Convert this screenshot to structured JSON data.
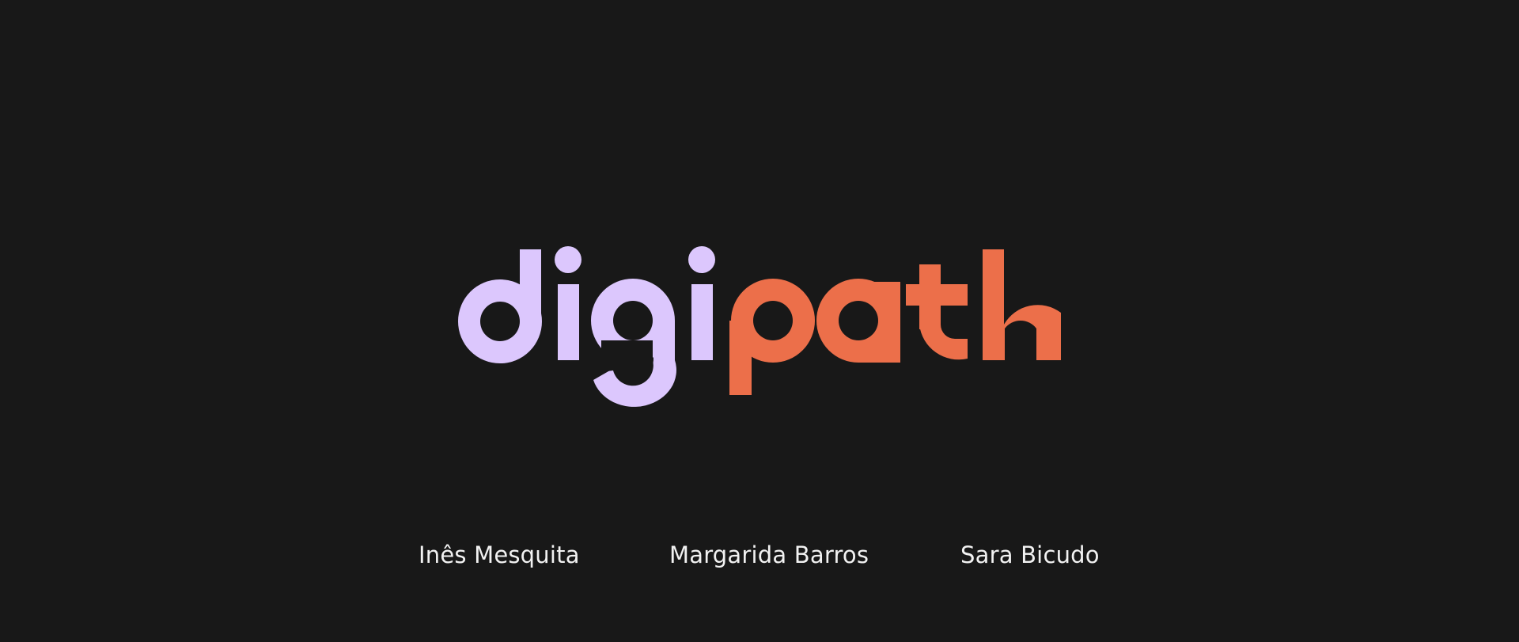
{
  "brand": {
    "wordmark": "digipath",
    "part_digi": "digi",
    "part_path": "path",
    "colors": {
      "background": "#181818",
      "digi": "#dcc7fd",
      "path": "#ec6f4a",
      "text": "#f2f2f2"
    }
  },
  "authors": [
    {
      "name": "Inês Mesquita"
    },
    {
      "name": "Margarida Barros"
    },
    {
      "name": "Sara Bicudo"
    }
  ]
}
